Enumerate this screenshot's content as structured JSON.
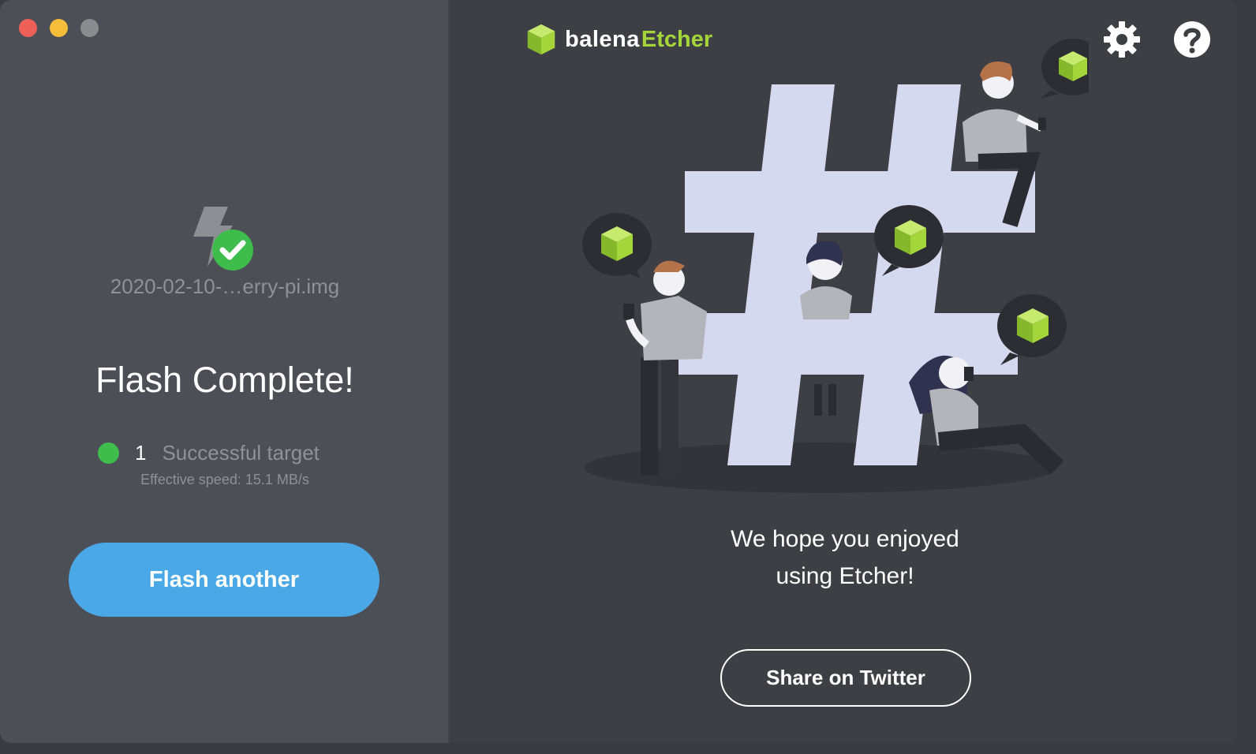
{
  "window": {
    "traffic_lights": [
      "close",
      "minimize",
      "zoom"
    ]
  },
  "left_panel": {
    "image_name": "2020-02-10-…erry-pi.img",
    "headline": "Flash Complete!",
    "result": {
      "count": "1",
      "label": "Successful target",
      "status_color": "#3ebc4c"
    },
    "speed": "Effective speed: 15.1 MB/s",
    "flash_another_label": "Flash another"
  },
  "header": {
    "brand_balena": "balena",
    "brand_etcher": "Etcher",
    "settings_icon": "gear-icon",
    "help_icon": "question-mark-icon"
  },
  "right_panel": {
    "message_line1": "We hope you enjoyed",
    "message_line2": "using Etcher!",
    "share_label": "Share on Twitter"
  },
  "colors": {
    "accent_blue": "#4ba8e7",
    "brand_green": "#a4d53a",
    "success_green": "#3ebc4c",
    "left_bg": "#4d4f57",
    "right_bg": "#3e3f44"
  }
}
